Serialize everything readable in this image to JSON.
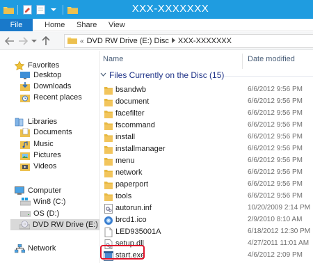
{
  "window": {
    "title": "XXX-XXXXXXX"
  },
  "ribbon": {
    "file_tab": "File",
    "tabs": [
      "Home",
      "Share",
      "View"
    ]
  },
  "address": {
    "prefix": "«",
    "crumbs": [
      "DVD RW Drive (E:) Disc",
      "XXX-XXXXXXX"
    ]
  },
  "nav": {
    "favorites": "Favorites",
    "desktop": "Desktop",
    "downloads": "Downloads",
    "recent": "Recent places",
    "libraries": "Libraries",
    "documents": "Documents",
    "music": "Music",
    "pictures": "Pictures",
    "videos": "Videos",
    "computer": "Computer",
    "win8": "Win8 (C:)",
    "os": "OS (D:)",
    "dvd": "DVD RW Drive (E:) D",
    "network": "Network"
  },
  "columns": {
    "name": "Name",
    "date": "Date modified"
  },
  "group": {
    "title": "Files Currently on the Disc (15)"
  },
  "files": [
    {
      "name": "bsandwb",
      "date": "6/6/2012 9:56 PM",
      "icon": "folder-icon"
    },
    {
      "name": "document",
      "date": "6/6/2012 9:56 PM",
      "icon": "folder-icon"
    },
    {
      "name": "facefilter",
      "date": "6/6/2012 9:56 PM",
      "icon": "folder-icon"
    },
    {
      "name": "fscommand",
      "date": "6/6/2012 9:56 PM",
      "icon": "folder-icon"
    },
    {
      "name": "install",
      "date": "6/6/2012 9:56 PM",
      "icon": "folder-icon"
    },
    {
      "name": "installmanager",
      "date": "6/6/2012 9:56 PM",
      "icon": "folder-icon"
    },
    {
      "name": "menu",
      "date": "6/6/2012 9:56 PM",
      "icon": "folder-icon"
    },
    {
      "name": "network",
      "date": "6/6/2012 9:56 PM",
      "icon": "folder-icon"
    },
    {
      "name": "paperport",
      "date": "6/6/2012 9:56 PM",
      "icon": "folder-icon"
    },
    {
      "name": "tools",
      "date": "6/6/2012 9:56 PM",
      "icon": "folder-icon"
    },
    {
      "name": "autorun.inf",
      "date": "10/20/2009 2:14 PM",
      "icon": "autorun-icon"
    },
    {
      "name": "brcd1.ico",
      "date": "2/9/2010 8:10 AM",
      "icon": "ico-file-icon"
    },
    {
      "name": "LED935001A",
      "date": "6/18/2012 12:30 PM",
      "icon": "document-icon"
    },
    {
      "name": "setup.dll",
      "date": "4/27/2011 11:01 AM",
      "icon": "dll-icon"
    },
    {
      "name": "start.exe",
      "date": "4/6/2012 2:09 PM",
      "icon": "exe-icon"
    }
  ],
  "colors": {
    "titlebar": "#1f9ce0",
    "file_tab": "#1979ca",
    "highlight": "#e0142b",
    "folder": "#f2c55c"
  }
}
